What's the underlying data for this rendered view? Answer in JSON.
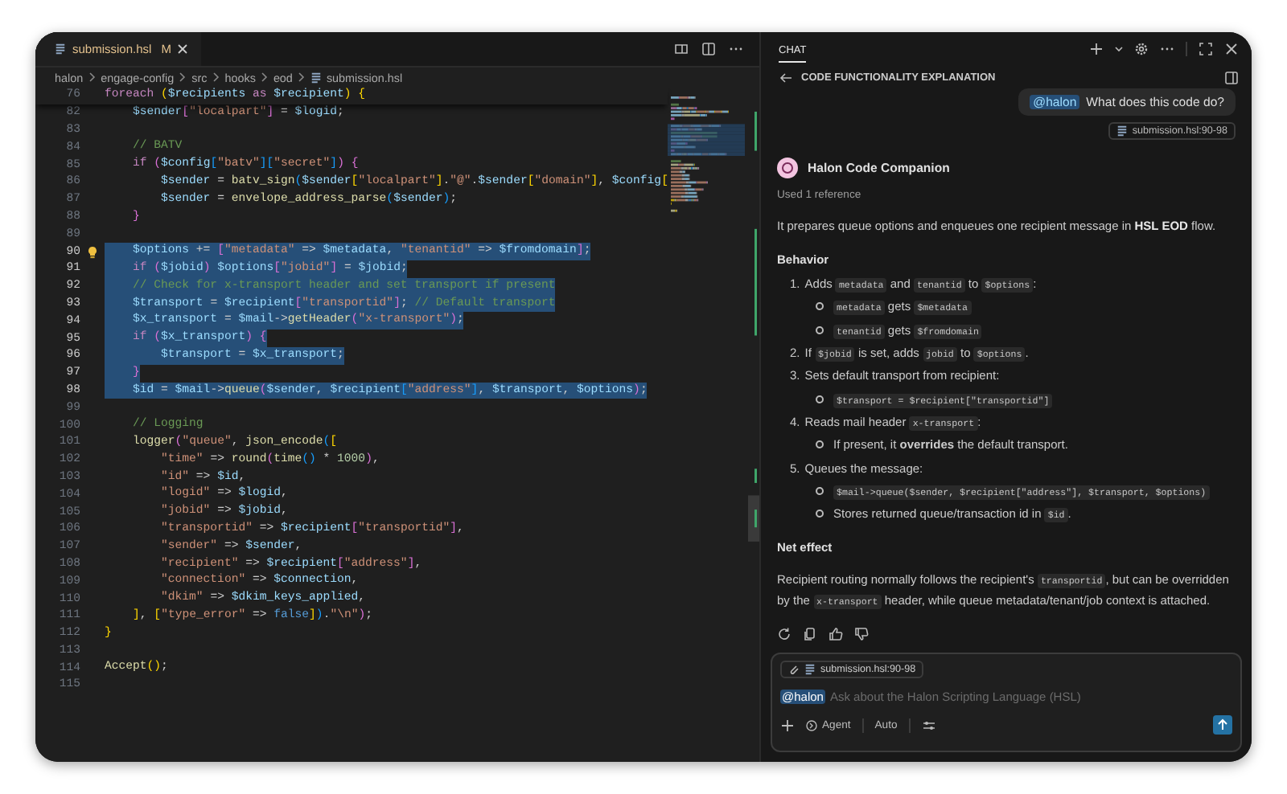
{
  "editor": {
    "tab": {
      "label": "submission.hsl",
      "status": "M"
    },
    "breadcrumbs": [
      "halon",
      "engage-config",
      "src",
      "hooks",
      "eod",
      "submission.hsl"
    ],
    "sticky_line": {
      "number": "76",
      "tokens": [
        {
          "kind": "k",
          "text": "foreach "
        },
        {
          "kind": "y",
          "text": "("
        },
        {
          "kind": "v",
          "text": "$recipients "
        },
        {
          "kind": "k",
          "text": "as "
        },
        {
          "kind": "v",
          "text": "$recipient"
        },
        {
          "kind": "y",
          "text": ")"
        },
        {
          "kind": "y",
          "text": " {"
        }
      ]
    },
    "lines": [
      {
        "number": "82",
        "selected": false,
        "lightbulb": false,
        "tokens": [
          {
            "kind": "v",
            "text": "    $sender"
          },
          {
            "kind": "m",
            "text": "["
          },
          {
            "kind": "s",
            "text": "\"localpart\""
          },
          {
            "kind": "m",
            "text": "]"
          },
          {
            "kind": "p",
            "text": " = "
          },
          {
            "kind": "v",
            "text": "$logid"
          },
          {
            "kind": "p",
            "text": ";"
          }
        ]
      },
      {
        "number": "83",
        "selected": false,
        "lightbulb": false
      },
      {
        "number": "84",
        "selected": false,
        "lightbulb": false,
        "tokens": [
          {
            "kind": "c",
            "text": "    // BATV"
          }
        ]
      },
      {
        "number": "85",
        "selected": false,
        "lightbulb": false,
        "tokens": [
          {
            "kind": "k",
            "text": "    if "
          },
          {
            "kind": "m",
            "text": "("
          },
          {
            "kind": "v",
            "text": "$config"
          },
          {
            "kind": "u",
            "text": "["
          },
          {
            "kind": "s",
            "text": "\"batv\""
          },
          {
            "kind": "u",
            "text": "]["
          },
          {
            "kind": "s",
            "text": "\"secret\""
          },
          {
            "kind": "u",
            "text": "]"
          },
          {
            "kind": "m",
            "text": ")"
          },
          {
            "kind": "m",
            "text": " {"
          }
        ]
      },
      {
        "number": "86",
        "selected": false,
        "lightbulb": false,
        "tokens": [
          {
            "kind": "v",
            "text": "        $sender"
          },
          {
            "kind": "p",
            "text": " = "
          },
          {
            "kind": "f",
            "text": "batv_sign"
          },
          {
            "kind": "u",
            "text": "("
          },
          {
            "kind": "v",
            "text": "$sender"
          },
          {
            "kind": "y",
            "text": "["
          },
          {
            "kind": "s",
            "text": "\"localpart\""
          },
          {
            "kind": "y",
            "text": "]"
          },
          {
            "kind": "p",
            "text": "."
          },
          {
            "kind": "s",
            "text": "\"@\""
          },
          {
            "kind": "p",
            "text": "."
          },
          {
            "kind": "v",
            "text": "$sender"
          },
          {
            "kind": "y",
            "text": "["
          },
          {
            "kind": "s",
            "text": "\"domain\""
          },
          {
            "kind": "y",
            "text": "]"
          },
          {
            "kind": "p",
            "text": ", "
          },
          {
            "kind": "v",
            "text": "$config"
          },
          {
            "kind": "y",
            "text": "["
          }
        ]
      },
      {
        "number": "87",
        "selected": false,
        "lightbulb": false,
        "tokens": [
          {
            "kind": "v",
            "text": "        $sender"
          },
          {
            "kind": "p",
            "text": " = "
          },
          {
            "kind": "f",
            "text": "envelope_address_parse"
          },
          {
            "kind": "u",
            "text": "("
          },
          {
            "kind": "v",
            "text": "$sender"
          },
          {
            "kind": "u",
            "text": ")"
          },
          {
            "kind": "p",
            "text": ";"
          }
        ]
      },
      {
        "number": "88",
        "selected": false,
        "lightbulb": false,
        "tokens": [
          {
            "kind": "m",
            "text": "    }"
          }
        ]
      },
      {
        "number": "89",
        "selected": false,
        "lightbulb": false
      },
      {
        "number": "90",
        "selected": true,
        "lightbulb": true,
        "tokens": [
          {
            "kind": "v",
            "text": "    $options"
          },
          {
            "kind": "p",
            "text": " += "
          },
          {
            "kind": "m",
            "text": "["
          },
          {
            "kind": "s",
            "text": "\"metadata\""
          },
          {
            "kind": "p",
            "text": " => "
          },
          {
            "kind": "v",
            "text": "$metadata"
          },
          {
            "kind": "p",
            "text": ", "
          },
          {
            "kind": "s",
            "text": "\"tenantid\""
          },
          {
            "kind": "p",
            "text": " => "
          },
          {
            "kind": "v",
            "text": "$fromdomain"
          },
          {
            "kind": "m",
            "text": "]"
          },
          {
            "kind": "p",
            "text": ";"
          }
        ]
      },
      {
        "number": "91",
        "selected": true,
        "lightbulb": false,
        "tokens": [
          {
            "kind": "k",
            "text": "    if "
          },
          {
            "kind": "m",
            "text": "("
          },
          {
            "kind": "v",
            "text": "$jobid"
          },
          {
            "kind": "m",
            "text": ")"
          },
          {
            "kind": "v",
            "text": " $options"
          },
          {
            "kind": "m",
            "text": "["
          },
          {
            "kind": "s",
            "text": "\"jobid\""
          },
          {
            "kind": "m",
            "text": "]"
          },
          {
            "kind": "p",
            "text": " = "
          },
          {
            "kind": "v",
            "text": "$jobid"
          },
          {
            "kind": "p",
            "text": ";"
          }
        ]
      },
      {
        "number": "92",
        "selected": true,
        "lightbulb": false,
        "tokens": [
          {
            "kind": "c",
            "text": "    // Check for x-transport header and set transport if present"
          }
        ]
      },
      {
        "number": "93",
        "selected": true,
        "lightbulb": false,
        "tokens": [
          {
            "kind": "v",
            "text": "    $transport"
          },
          {
            "kind": "p",
            "text": " = "
          },
          {
            "kind": "v",
            "text": "$recipient"
          },
          {
            "kind": "m",
            "text": "["
          },
          {
            "kind": "s",
            "text": "\"transportid\""
          },
          {
            "kind": "m",
            "text": "]"
          },
          {
            "kind": "p",
            "text": ";"
          },
          {
            "kind": "c",
            "text": " // Default transport"
          }
        ]
      },
      {
        "number": "94",
        "selected": true,
        "lightbulb": false,
        "tokens": [
          {
            "kind": "v",
            "text": "    $x_transport"
          },
          {
            "kind": "p",
            "text": " = "
          },
          {
            "kind": "v",
            "text": "$mail"
          },
          {
            "kind": "p",
            "text": "->"
          },
          {
            "kind": "f",
            "text": "getHeader"
          },
          {
            "kind": "m",
            "text": "("
          },
          {
            "kind": "s",
            "text": "\"x-transport\""
          },
          {
            "kind": "m",
            "text": ")"
          },
          {
            "kind": "p",
            "text": ";"
          }
        ]
      },
      {
        "number": "95",
        "selected": true,
        "lightbulb": false,
        "tokens": [
          {
            "kind": "k",
            "text": "    if "
          },
          {
            "kind": "m",
            "text": "("
          },
          {
            "kind": "v",
            "text": "$x_transport"
          },
          {
            "kind": "m",
            "text": ")"
          },
          {
            "kind": "m",
            "text": " {"
          }
        ]
      },
      {
        "number": "96",
        "selected": true,
        "lightbulb": false,
        "tokens": [
          {
            "kind": "v",
            "text": "        $transport"
          },
          {
            "kind": "p",
            "text": " = "
          },
          {
            "kind": "v",
            "text": "$x_transport"
          },
          {
            "kind": "p",
            "text": ";"
          }
        ]
      },
      {
        "number": "97",
        "selected": true,
        "lightbulb": false,
        "tokens": [
          {
            "kind": "m",
            "text": "    }"
          }
        ]
      },
      {
        "number": "98",
        "selected": true,
        "lightbulb": false,
        "tokens": [
          {
            "kind": "v",
            "text": "    $id"
          },
          {
            "kind": "p",
            "text": " = "
          },
          {
            "kind": "v",
            "text": "$mail"
          },
          {
            "kind": "p",
            "text": "->"
          },
          {
            "kind": "f",
            "text": "queue"
          },
          {
            "kind": "m",
            "text": "("
          },
          {
            "kind": "v",
            "text": "$sender"
          },
          {
            "kind": "p",
            "text": ", "
          },
          {
            "kind": "v",
            "text": "$recipient"
          },
          {
            "kind": "u",
            "text": "["
          },
          {
            "kind": "s",
            "text": "\"address\""
          },
          {
            "kind": "u",
            "text": "]"
          },
          {
            "kind": "p",
            "text": ", "
          },
          {
            "kind": "v",
            "text": "$transport"
          },
          {
            "kind": "p",
            "text": ", "
          },
          {
            "kind": "v",
            "text": "$options"
          },
          {
            "kind": "m",
            "text": ")"
          },
          {
            "kind": "p",
            "text": ";"
          }
        ]
      },
      {
        "number": "99",
        "selected": false,
        "lightbulb": false
      },
      {
        "number": "100",
        "selected": false,
        "lightbulb": false,
        "tokens": [
          {
            "kind": "c",
            "text": "    // Logging"
          }
        ]
      },
      {
        "number": "101",
        "selected": false,
        "lightbulb": false,
        "tokens": [
          {
            "kind": "f",
            "text": "    logger"
          },
          {
            "kind": "m",
            "text": "("
          },
          {
            "kind": "s",
            "text": "\"queue\""
          },
          {
            "kind": "p",
            "text": ", "
          },
          {
            "kind": "f",
            "text": "json_encode"
          },
          {
            "kind": "u",
            "text": "("
          },
          {
            "kind": "y",
            "text": "["
          }
        ]
      },
      {
        "number": "102",
        "selected": false,
        "lightbulb": false,
        "tokens": [
          {
            "kind": "s",
            "text": "        \"time\""
          },
          {
            "kind": "p",
            "text": " => "
          },
          {
            "kind": "f",
            "text": "round"
          },
          {
            "kind": "m",
            "text": "("
          },
          {
            "kind": "f",
            "text": "time"
          },
          {
            "kind": "u",
            "text": "()"
          },
          {
            "kind": "p",
            "text": " * "
          },
          {
            "kind": "n",
            "text": "1000"
          },
          {
            "kind": "m",
            "text": ")"
          },
          {
            "kind": "p",
            "text": ","
          }
        ]
      },
      {
        "number": "103",
        "selected": false,
        "lightbulb": false,
        "tokens": [
          {
            "kind": "s",
            "text": "        \"id\""
          },
          {
            "kind": "p",
            "text": " => "
          },
          {
            "kind": "v",
            "text": "$id"
          },
          {
            "kind": "p",
            "text": ","
          }
        ]
      },
      {
        "number": "104",
        "selected": false,
        "lightbulb": false,
        "tokens": [
          {
            "kind": "s",
            "text": "        \"logid\""
          },
          {
            "kind": "p",
            "text": " => "
          },
          {
            "kind": "v",
            "text": "$logid"
          },
          {
            "kind": "p",
            "text": ","
          }
        ]
      },
      {
        "number": "105",
        "selected": false,
        "lightbulb": false,
        "tokens": [
          {
            "kind": "s",
            "text": "        \"jobid\""
          },
          {
            "kind": "p",
            "text": " => "
          },
          {
            "kind": "v",
            "text": "$jobid"
          },
          {
            "kind": "p",
            "text": ","
          }
        ]
      },
      {
        "number": "106",
        "selected": false,
        "lightbulb": false,
        "tokens": [
          {
            "kind": "s",
            "text": "        \"transportid\""
          },
          {
            "kind": "p",
            "text": " => "
          },
          {
            "kind": "v",
            "text": "$recipient"
          },
          {
            "kind": "m",
            "text": "["
          },
          {
            "kind": "s",
            "text": "\"transportid\""
          },
          {
            "kind": "m",
            "text": "]"
          },
          {
            "kind": "p",
            "text": ","
          }
        ]
      },
      {
        "number": "107",
        "selected": false,
        "lightbulb": false,
        "tokens": [
          {
            "kind": "s",
            "text": "        \"sender\""
          },
          {
            "kind": "p",
            "text": " => "
          },
          {
            "kind": "v",
            "text": "$sender"
          },
          {
            "kind": "p",
            "text": ","
          }
        ]
      },
      {
        "number": "108",
        "selected": false,
        "lightbulb": false,
        "tokens": [
          {
            "kind": "s",
            "text": "        \"recipient\""
          },
          {
            "kind": "p",
            "text": " => "
          },
          {
            "kind": "v",
            "text": "$recipient"
          },
          {
            "kind": "m",
            "text": "["
          },
          {
            "kind": "s",
            "text": "\"address\""
          },
          {
            "kind": "m",
            "text": "]"
          },
          {
            "kind": "p",
            "text": ","
          }
        ]
      },
      {
        "number": "109",
        "selected": false,
        "lightbulb": false,
        "tokens": [
          {
            "kind": "s",
            "text": "        \"connection\""
          },
          {
            "kind": "p",
            "text": " => "
          },
          {
            "kind": "v",
            "text": "$connection"
          },
          {
            "kind": "p",
            "text": ","
          }
        ]
      },
      {
        "number": "110",
        "selected": false,
        "lightbulb": false,
        "tokens": [
          {
            "kind": "s",
            "text": "        \"dkim\""
          },
          {
            "kind": "p",
            "text": " => "
          },
          {
            "kind": "v",
            "text": "$dkim_keys_applied"
          },
          {
            "kind": "p",
            "text": ","
          }
        ]
      },
      {
        "number": "111",
        "selected": false,
        "lightbulb": false,
        "tokens": [
          {
            "kind": "y",
            "text": "    ]"
          },
          {
            "kind": "p",
            "text": ", "
          },
          {
            "kind": "y",
            "text": "["
          },
          {
            "kind": "s",
            "text": "\"type_error\""
          },
          {
            "kind": "p",
            "text": " => "
          },
          {
            "kind": "l",
            "text": "false"
          },
          {
            "kind": "y",
            "text": "]"
          },
          {
            "kind": "u",
            "text": ")"
          },
          {
            "kind": "p",
            "text": "."
          },
          {
            "kind": "s",
            "text": "\"\\n\""
          },
          {
            "kind": "m",
            "text": ")"
          },
          {
            "kind": "p",
            "text": ";"
          }
        ]
      },
      {
        "number": "112",
        "selected": false,
        "lightbulb": false,
        "tokens": [
          {
            "kind": "y",
            "text": "}"
          }
        ]
      },
      {
        "number": "113",
        "selected": false,
        "lightbulb": false
      },
      {
        "number": "114",
        "selected": false,
        "lightbulb": false,
        "tokens": [
          {
            "kind": "f",
            "text": "Accept"
          },
          {
            "kind": "y",
            "text": "()"
          },
          {
            "kind": "p",
            "text": ";"
          }
        ]
      },
      {
        "number": "115",
        "selected": false,
        "lightbulb": false
      }
    ]
  },
  "chat": {
    "tab": "CHAT",
    "title": "CODE FUNCTIONALITY EXPLANATION",
    "user_message": {
      "mention": "@halon",
      "text": "What does this code do?"
    },
    "reference_chip": "submission.hsl:90-98",
    "assistant": {
      "name": "Halon Code Companion",
      "references": "Used 1 reference"
    },
    "blocks": [
      {
        "kind": "para",
        "parts": [
          {
            "kind": "t",
            "text": "It prepares queue options and enqueues one recipient message in "
          },
          {
            "kind": "b",
            "text": "HSL EOD"
          },
          {
            "kind": "t",
            "text": " flow."
          }
        ]
      },
      {
        "kind": "heading",
        "text": "Behavior"
      },
      {
        "kind": "list",
        "items": [
          {
            "number": "1.",
            "parts": [
              {
                "kind": "t",
                "text": "Adds "
              },
              {
                "kind": "c",
                "text": "metadata"
              },
              {
                "kind": "t",
                "text": " and "
              },
              {
                "kind": "c",
                "text": "tenantid"
              },
              {
                "kind": "t",
                "text": " to "
              },
              {
                "kind": "c",
                "text": "$options"
              },
              {
                "kind": "t",
                "text": ":"
              }
            ],
            "children": [
              {
                "parts": [
                  {
                    "kind": "c",
                    "text": "metadata"
                  },
                  {
                    "kind": "t",
                    "text": " gets "
                  },
                  {
                    "kind": "c",
                    "text": "$metadata"
                  }
                ]
              },
              {
                "parts": [
                  {
                    "kind": "c",
                    "text": "tenantid"
                  },
                  {
                    "kind": "t",
                    "text": " gets "
                  },
                  {
                    "kind": "c",
                    "text": "$fromdomain"
                  }
                ]
              }
            ]
          },
          {
            "number": "2.",
            "parts": [
              {
                "kind": "t",
                "text": "If "
              },
              {
                "kind": "c",
                "text": "$jobid"
              },
              {
                "kind": "t",
                "text": " is set, adds "
              },
              {
                "kind": "c",
                "text": "jobid"
              },
              {
                "kind": "t",
                "text": " to "
              },
              {
                "kind": "c",
                "text": "$options"
              },
              {
                "kind": "t",
                "text": "."
              }
            ]
          },
          {
            "number": "3.",
            "parts": [
              {
                "kind": "t",
                "text": "Sets default transport from recipient:"
              }
            ],
            "children": [
              {
                "parts": [
                  {
                    "kind": "c",
                    "text": "$transport = $recipient[\"transportid\"]"
                  }
                ]
              }
            ]
          },
          {
            "number": "4.",
            "parts": [
              {
                "kind": "t",
                "text": "Reads mail header "
              },
              {
                "kind": "c",
                "text": "x-transport"
              },
              {
                "kind": "t",
                "text": ":"
              }
            ],
            "children": [
              {
                "parts": [
                  {
                    "kind": "t",
                    "text": "If present, it "
                  },
                  {
                    "kind": "b",
                    "text": "overrides"
                  },
                  {
                    "kind": "t",
                    "text": " the default transport."
                  }
                ]
              }
            ]
          },
          {
            "number": "5.",
            "parts": [
              {
                "kind": "t",
                "text": "Queues the message:"
              }
            ],
            "children": [
              {
                "parts": [
                  {
                    "kind": "c",
                    "text": "$mail->queue($sender, $recipient[\"address\"], $transport, $options)"
                  }
                ]
              },
              {
                "parts": [
                  {
                    "kind": "t",
                    "text": "Stores returned queue/transaction id in "
                  },
                  {
                    "kind": "c",
                    "text": "$id"
                  },
                  {
                    "kind": "t",
                    "text": "."
                  }
                ]
              }
            ]
          }
        ]
      },
      {
        "kind": "heading",
        "text": "Net effect"
      },
      {
        "kind": "para",
        "parts": [
          {
            "kind": "t",
            "text": "Recipient routing normally follows the recipient's "
          },
          {
            "kind": "c",
            "text": "transportid"
          },
          {
            "kind": "t",
            "text": ", but can be overridden by the "
          },
          {
            "kind": "c",
            "text": "x-transport"
          },
          {
            "kind": "t",
            "text": " header, while queue metadata/tenant/job context is attached."
          }
        ]
      }
    ],
    "input": {
      "chip": "submission.hsl:90-98",
      "mention": "@halon",
      "placeholder": "Ask about the Halon Scripting Language (HSL)",
      "mode": "Agent",
      "model": "Auto"
    }
  }
}
